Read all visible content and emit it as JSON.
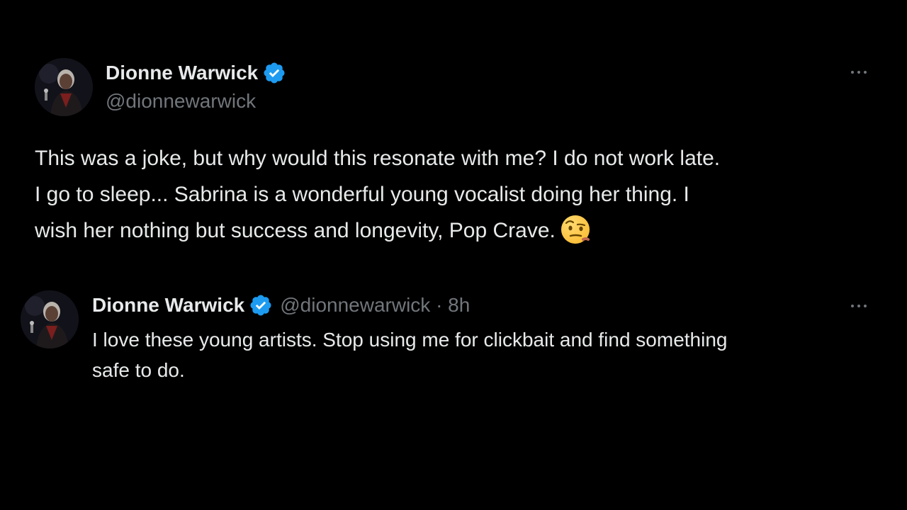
{
  "main_tweet": {
    "author": {
      "display_name": "Dionne Warwick",
      "handle": "@dionnewarwick",
      "verified": true
    },
    "text_lines": [
      "This was a joke, but why would this resonate with me? I do not work late.",
      "I go to sleep... Sabrina is a wonderful young vocalist doing her thing. I",
      "wish her nothing but success and longevity, Pop Crave."
    ],
    "emoji": "face-with-raised-eyebrow",
    "menu_icon": "more-horizontal-icon"
  },
  "reply_tweet": {
    "author": {
      "display_name": "Dionne Warwick",
      "handle": "@dionnewarwick",
      "verified": true
    },
    "meta": "@dionnewarwick · 8h",
    "text_lines": [
      "I love these young artists. Stop using me for clickbait and find something",
      "safe to do."
    ],
    "menu_icon": "more-horizontal-icon"
  },
  "colors": {
    "background": "#000000",
    "primary_text": "#e7e9ea",
    "secondary_text": "#71767b",
    "verified_badge": "#1d9bf0"
  }
}
